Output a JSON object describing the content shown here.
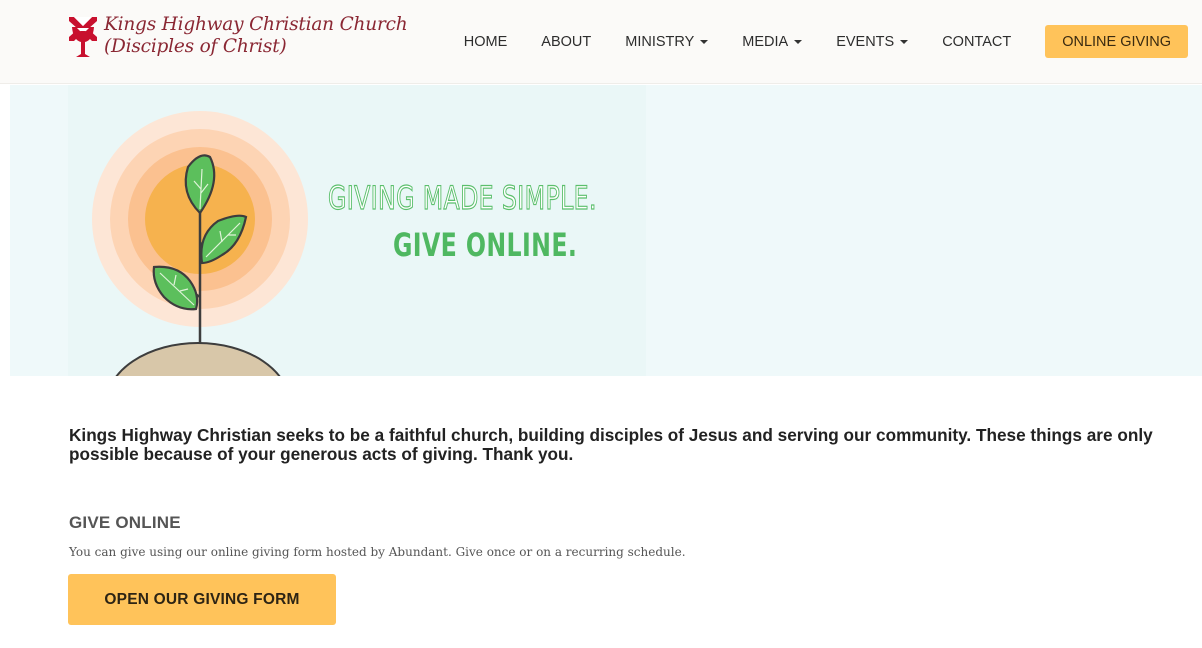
{
  "brand": {
    "line1": "Kings Highway Christian Church",
    "line2": "(Disciples of Christ)",
    "color": "#8a2733"
  },
  "nav": {
    "items": [
      {
        "label": "HOME",
        "dropdown": false
      },
      {
        "label": "ABOUT",
        "dropdown": false
      },
      {
        "label": "MINISTRY",
        "dropdown": true
      },
      {
        "label": "MEDIA",
        "dropdown": true
      },
      {
        "label": "EVENTS",
        "dropdown": true
      },
      {
        "label": "CONTACT",
        "dropdown": false
      }
    ],
    "cta_label": "ONLINE GIVING",
    "cta_color": "#ffc35a"
  },
  "hero": {
    "line1": "GIVING MADE SIMPLE.",
    "line2": "GIVE ONLINE.",
    "accent_color": "#4fb861",
    "icon": "plant-sprout-with-sun"
  },
  "content": {
    "intro": "Kings Highway Christian seeks to be a faithful church, building disciples of Jesus and serving our community.  These things are only possible because of your generous acts of giving. Thank you.",
    "section_heading": "GIVE ONLINE",
    "section_text": "You can give using our online giving form hosted by Abundant. Give once or on a recurring schedule.",
    "button_label": "OPEN OUR GIVING FORM"
  }
}
